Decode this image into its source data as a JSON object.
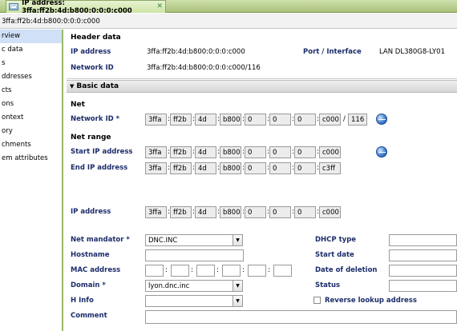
{
  "tab": {
    "title": "IP address: 3ffa:ff2b:4d:b800:0:0:0:c000",
    "close_icon": "close-icon"
  },
  "path": "3ffa:ff2b:4d:b800:0:0:0:c000",
  "sidebar": {
    "items": [
      {
        "label": "rview",
        "active": true
      },
      {
        "label": "c data"
      },
      {
        "label": "s"
      },
      {
        "label": "ddresses"
      },
      {
        "label": "cts"
      },
      {
        "label": "ons"
      },
      {
        "label": "ontext"
      },
      {
        "label": "ory"
      },
      {
        "label": "chments"
      },
      {
        "label": "em attributes"
      }
    ]
  },
  "header": {
    "title": "Header data",
    "ip_label": "IP address",
    "ip_value": "3ffa:ff2b:4d:b800:0:0:0:c000",
    "port_label": "Port / Interface",
    "port_value": "LAN DL380G8-LY01",
    "netid_label": "Network ID",
    "netid_value": "3ffa:ff2b:4d:b800:0:0:0:c000/116"
  },
  "basic": {
    "title": "Basic data",
    "net_title": "Net",
    "network_id_label": "Network ID *",
    "network_id": [
      "3ffa",
      "ff2b",
      "4d",
      "b800",
      "0",
      "0",
      "0",
      "c000"
    ],
    "network_prefix": "116",
    "net_range_title": "Net range",
    "start_ip_label": "Start IP address",
    "start_ip": [
      "3ffa",
      "ff2b",
      "4d",
      "b800",
      "0",
      "0",
      "0",
      "c000"
    ],
    "end_ip_label": "End IP address",
    "end_ip": [
      "3ffa",
      "ff2b",
      "4d",
      "b800",
      "0",
      "0",
      "0",
      "c3ff"
    ],
    "ip_label": "IP address",
    "ip": [
      "3ffa",
      "ff2b",
      "4d",
      "b800",
      "0",
      "0",
      "0",
      "c000"
    ]
  },
  "form": {
    "net_mandator_label": "Net mandator *",
    "net_mandator_value": "DNC.INC",
    "hostname_label": "Hostname",
    "hostname_value": "",
    "mac_label": "MAC address",
    "domain_label": "Domain *",
    "domain_value": "lyon.dnc.inc",
    "hinfo_label": "H Info",
    "hinfo_value": "",
    "comment_label": "Comment",
    "dhcp_label": "DHCP type",
    "start_date_label": "Start date",
    "deletion_label": "Date of deletion",
    "status_label": "Status",
    "reverse_lookup_label": "Reverse lookup address",
    "reverse_lookup_checked": false
  }
}
